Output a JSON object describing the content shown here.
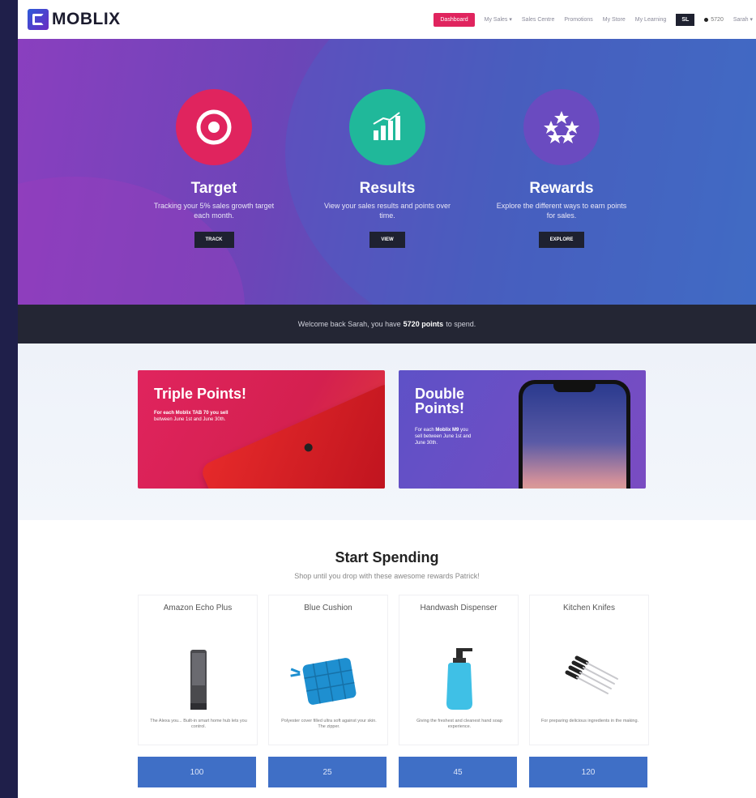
{
  "nav": {
    "logo": "MOBLIX",
    "links": [
      {
        "label": "Dashboard",
        "active": true
      },
      {
        "label": "My Sales",
        "active": false
      },
      {
        "label": "Sales Centre",
        "active": false
      },
      {
        "label": "Promotions",
        "active": false
      },
      {
        "label": "My Store",
        "active": false
      },
      {
        "label": "My Learning",
        "active": false
      }
    ],
    "dark_button": "SL",
    "points": "5720",
    "user": "Sarah"
  },
  "hero": {
    "features": [
      {
        "title": "Target",
        "desc": "Tracking your 5% sales growth target each month.",
        "button": "TRACK"
      },
      {
        "title": "Results",
        "desc": "View your sales results and points over time.",
        "button": "VIEW"
      },
      {
        "title": "Rewards",
        "desc": "Explore the different ways to earn points for sales.",
        "button": "EXPLORE"
      }
    ]
  },
  "welcome": {
    "prefix": "Welcome back Sarah, you have",
    "points": "5720 points",
    "suffix": "to spend."
  },
  "promos": [
    {
      "title": "Triple Points!",
      "bold": "For each Moblix TAB 70 you sell",
      "rest": "between June 1st and June 30th."
    },
    {
      "title": "Double Points!",
      "lead": "For each",
      "bold": "Moblix M9",
      "rest": "you sell between June 1st and June 30th."
    }
  ],
  "spend": {
    "title": "Start Spending",
    "subtitle": "Shop until you drop with these awesome rewards Patrick!"
  },
  "products": [
    {
      "name": "Amazon Echo Plus",
      "desc": "The Alexa you... Built-in smart home hub lets you control.",
      "price": "100"
    },
    {
      "name": "Blue Cushion",
      "desc": "Polyester cover filled ultra soft against your skin. The zipper.",
      "price": "25"
    },
    {
      "name": "Handwash Dispenser",
      "desc": "Giving the freshest and cleanest hand soap experience.",
      "price": "45"
    },
    {
      "name": "Kitchen Knifes",
      "desc": "For preparing delicious ingredients in the making.",
      "price": "120"
    }
  ],
  "colors": {
    "accent": "#e0245e",
    "primary": "#3f6fc6",
    "dark": "#1e2130",
    "teal": "#20b89a"
  }
}
